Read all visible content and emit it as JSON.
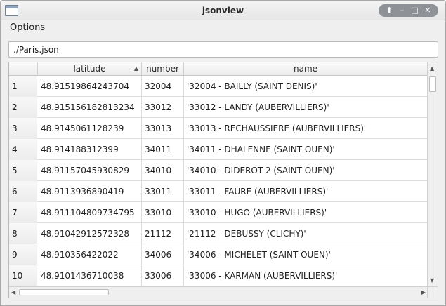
{
  "window": {
    "title": "jsonview"
  },
  "titlebar": {
    "buttons": [
      {
        "icon": "up-arrow-icon",
        "glyph": "⬆"
      },
      {
        "icon": "minimize-icon",
        "glyph": "–"
      },
      {
        "icon": "maximize-icon",
        "glyph": "□"
      },
      {
        "icon": "close-icon",
        "glyph": "✕"
      }
    ]
  },
  "menubar": {
    "items": [
      "Options"
    ]
  },
  "path": {
    "value": "./Paris.json"
  },
  "table": {
    "columns": [
      {
        "label": "latitude",
        "sorted": "ascending"
      },
      {
        "label": "number"
      },
      {
        "label": "name"
      }
    ],
    "rows": [
      {
        "num": "1",
        "latitude": "48.91519864243704",
        "number": "32004",
        "name": "'32004 - BAILLY (SAINT DENIS)'"
      },
      {
        "num": "2",
        "latitude": "48.915156182813234",
        "number": "33012",
        "name": "'33012 - LANDY (AUBERVILLIERS)'"
      },
      {
        "num": "3",
        "latitude": "48.9145061128239",
        "number": "33013",
        "name": "'33013 - RECHAUSSIERE (AUBERVILLIERS)'"
      },
      {
        "num": "4",
        "latitude": "48.914188312399",
        "number": "34011",
        "name": "'34011 - DHALENNE (SAINT OUEN)'"
      },
      {
        "num": "5",
        "latitude": "48.91157045930829",
        "number": "34010",
        "name": "'34010 - DIDEROT 2 (SAINT OUEN)'"
      },
      {
        "num": "6",
        "latitude": "48.9113936890419",
        "number": "33011",
        "name": "'33011 - FAURE (AUBERVILLIERS)'"
      },
      {
        "num": "7",
        "latitude": "48.911104809734795",
        "number": "33010",
        "name": "'33010 - HUGO (AUBERVILLIERS)'"
      },
      {
        "num": "8",
        "latitude": "48.91042912572328",
        "number": "21112",
        "name": "'21112 - DEBUSSY (CLICHY)'"
      },
      {
        "num": "9",
        "latitude": "48.910356422022",
        "number": "34006",
        "name": "'34006 - MICHELET (SAINT OUEN)'"
      },
      {
        "num": "10",
        "latitude": "48.9101436710038",
        "number": "33006",
        "name": "'33006 - KARMAN (AUBERVILLIERS)'"
      }
    ]
  }
}
